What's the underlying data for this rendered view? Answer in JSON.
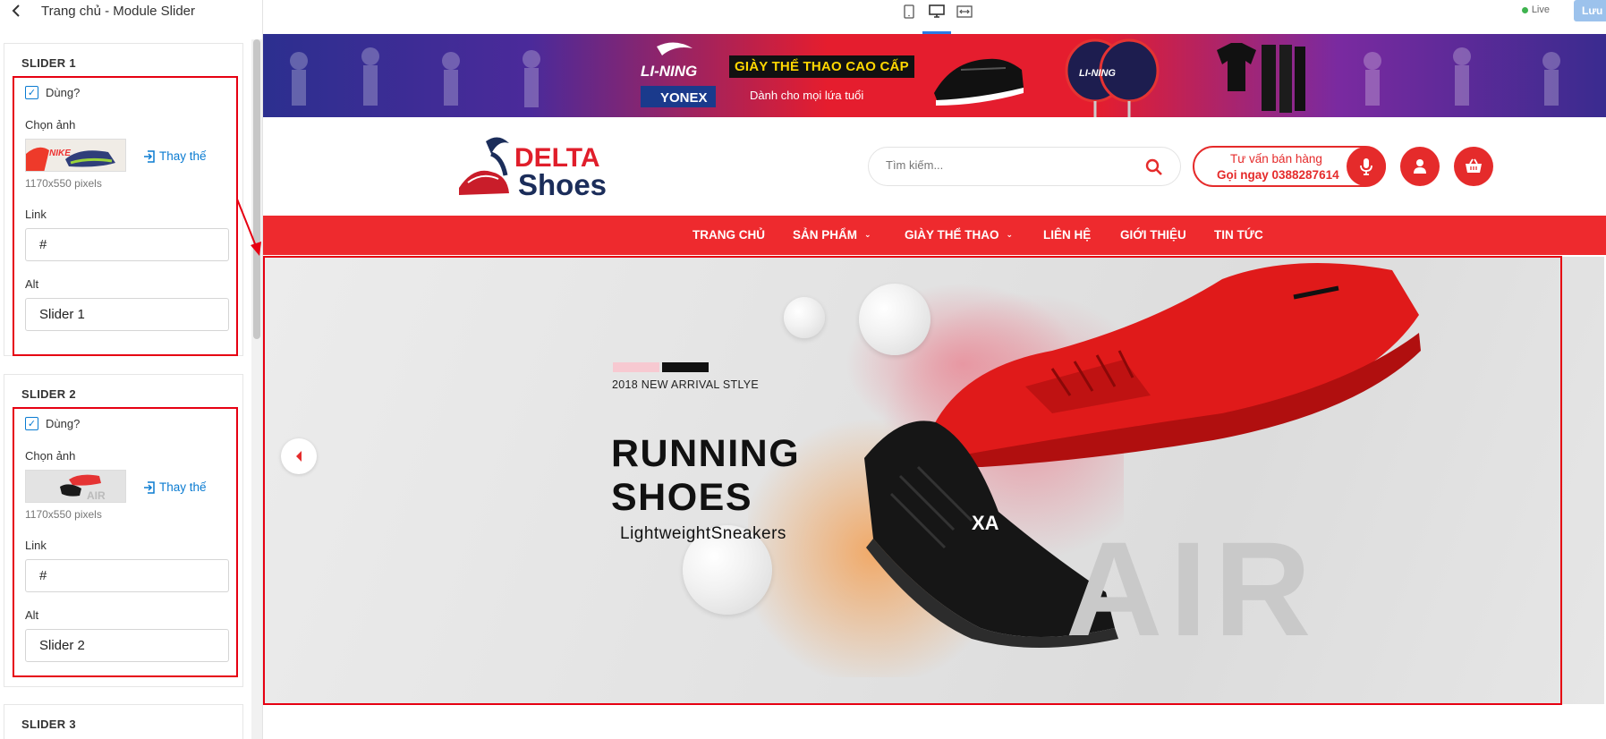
{
  "panel": {
    "title": "Trang chủ - Module Slider",
    "sliders": [
      {
        "heading": "SLIDER 1",
        "enabled_label": "Dùng?",
        "image_label": "Chọn ảnh",
        "replace_label": "Thay thế",
        "dims": "1170x550 pixels",
        "link_label": "Link",
        "link_value": "#",
        "alt_label": "Alt",
        "alt_value": "Slider 1"
      },
      {
        "heading": "SLIDER 2",
        "enabled_label": "Dùng?",
        "image_label": "Chọn ảnh",
        "replace_label": "Thay thế",
        "dims": "1170x550 pixels",
        "link_label": "Link",
        "link_value": "#",
        "alt_label": "Alt",
        "alt_value": "Slider 2"
      },
      {
        "heading": "SLIDER 3"
      }
    ]
  },
  "toolbar": {
    "live_label": "Live",
    "save_label": "Lưu",
    "devices": [
      "tablet-icon",
      "desktop-icon",
      "fullwidth-icon"
    ],
    "active_device": "desktop"
  },
  "site": {
    "top_banner": {
      "brand_1": "LI-NING",
      "brand_2": "YONEX",
      "slogan": "GIÀY THỂ THAO CAO CẤP",
      "sub": "Dành cho mọi lứa tuổi"
    },
    "logo": {
      "part1": "DELTA",
      "part2": "Shoes"
    },
    "search_placeholder": "Tìm kiếm...",
    "hotline_line1": "Tư vấn bán hàng",
    "hotline_line2": "Gọi ngay 0388287614",
    "nav": [
      {
        "label": "TRANG CHỦ",
        "dropdown": false
      },
      {
        "label": "SẢN PHẨM",
        "dropdown": true
      },
      {
        "label": "GIÀY THỂ THAO",
        "dropdown": true
      },
      {
        "label": "LIÊN HỆ",
        "dropdown": false
      },
      {
        "label": "GIỚI THIỆU",
        "dropdown": false
      },
      {
        "label": "TIN TỨC",
        "dropdown": false
      }
    ],
    "hero": {
      "eyebrow": "2018 NEW ARRIVAL STLYE",
      "title_line1": "RUNNING",
      "title_line2": "SHOES",
      "subtitle": "LightweightSneakers",
      "watermark": "AIR",
      "shoe_text": "XA"
    }
  },
  "colors": {
    "accent_red": "#ee2a2e",
    "highlight_red": "#e60012",
    "link_blue": "#0a7bd1"
  }
}
